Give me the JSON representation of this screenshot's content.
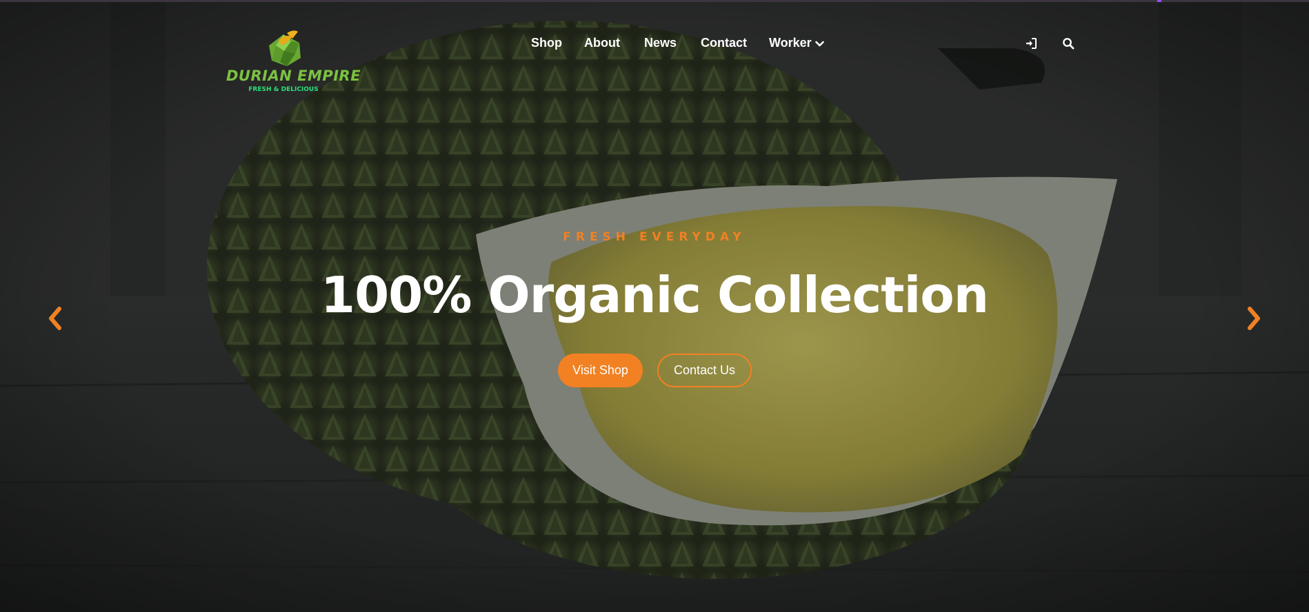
{
  "brand": {
    "name": "DURIAN EMPIRE",
    "tagline": "FRESH & DELICIOUS",
    "logo_icon": "durian-logo-icon",
    "primary_color": "#7cc242",
    "tagline_color": "#2ee07a"
  },
  "nav": {
    "items": [
      {
        "label": "Shop"
      },
      {
        "label": "About"
      },
      {
        "label": "News"
      },
      {
        "label": "Contact"
      },
      {
        "label": "Worker",
        "icon": "chevron-down-icon"
      }
    ]
  },
  "utility": {
    "login_icon": "sign-in-icon",
    "search_icon": "search-icon"
  },
  "hero": {
    "subtitle": "FRESH EVERYDAY",
    "title": "100% Organic Collection",
    "primary_button": "Visit Shop",
    "secondary_button": "Contact Us",
    "accent_color": "#f28123",
    "background_image": "durian fruit on wooden table (dark overlay)"
  },
  "carousel": {
    "prev_icon": "chevron-left-icon",
    "next_icon": "chevron-right-icon"
  }
}
